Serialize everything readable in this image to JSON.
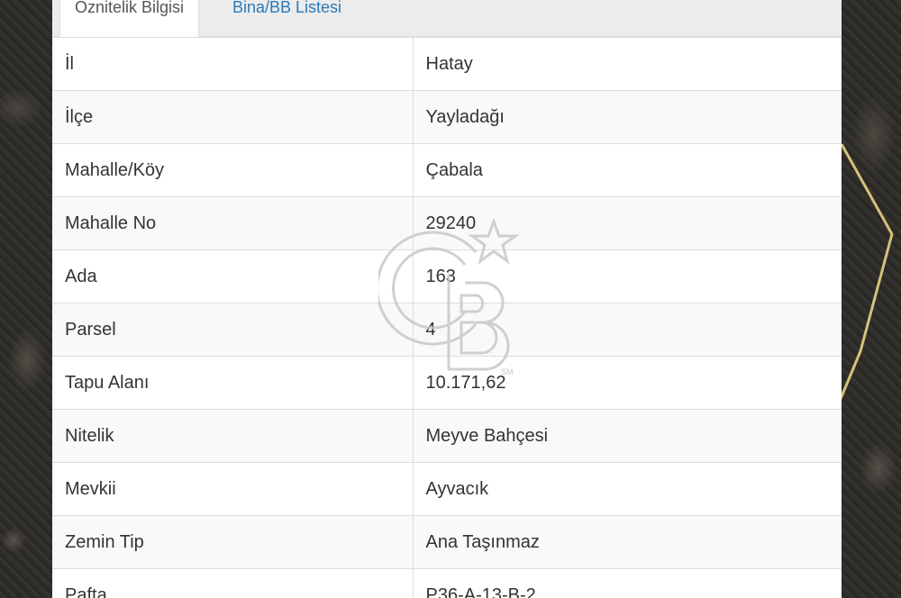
{
  "tabs": [
    {
      "label": "Öznitelik Bilgisi",
      "active": true
    },
    {
      "label": "Bina/BB Listesi",
      "active": false
    }
  ],
  "attributes": [
    {
      "label": "İl",
      "value": "Hatay"
    },
    {
      "label": "İlçe",
      "value": "Yayladağı"
    },
    {
      "label": "Mahalle/Köy",
      "value": "Çabala"
    },
    {
      "label": "Mahalle No",
      "value": "29240"
    },
    {
      "label": "Ada",
      "value": "163"
    },
    {
      "label": "Parsel",
      "value": "4"
    },
    {
      "label": "Tapu Alanı",
      "value": "10.171,62"
    },
    {
      "label": "Nitelik",
      "value": "Meyve Bahçesi"
    },
    {
      "label": "Mevkii",
      "value": "Ayvacık"
    },
    {
      "label": "Zemin Tip",
      "value": "Ana Taşınmaz"
    },
    {
      "label": "Pafta",
      "value": "P36-A-13-B-2"
    }
  ],
  "watermark": {
    "icon": "cb-logo-icon",
    "text": "CB",
    "mark": "SM"
  },
  "colors": {
    "tab_active_text": "#555555",
    "tab_inactive_text": "#2a7ab8",
    "parcel_outline": "#d6c17a"
  }
}
